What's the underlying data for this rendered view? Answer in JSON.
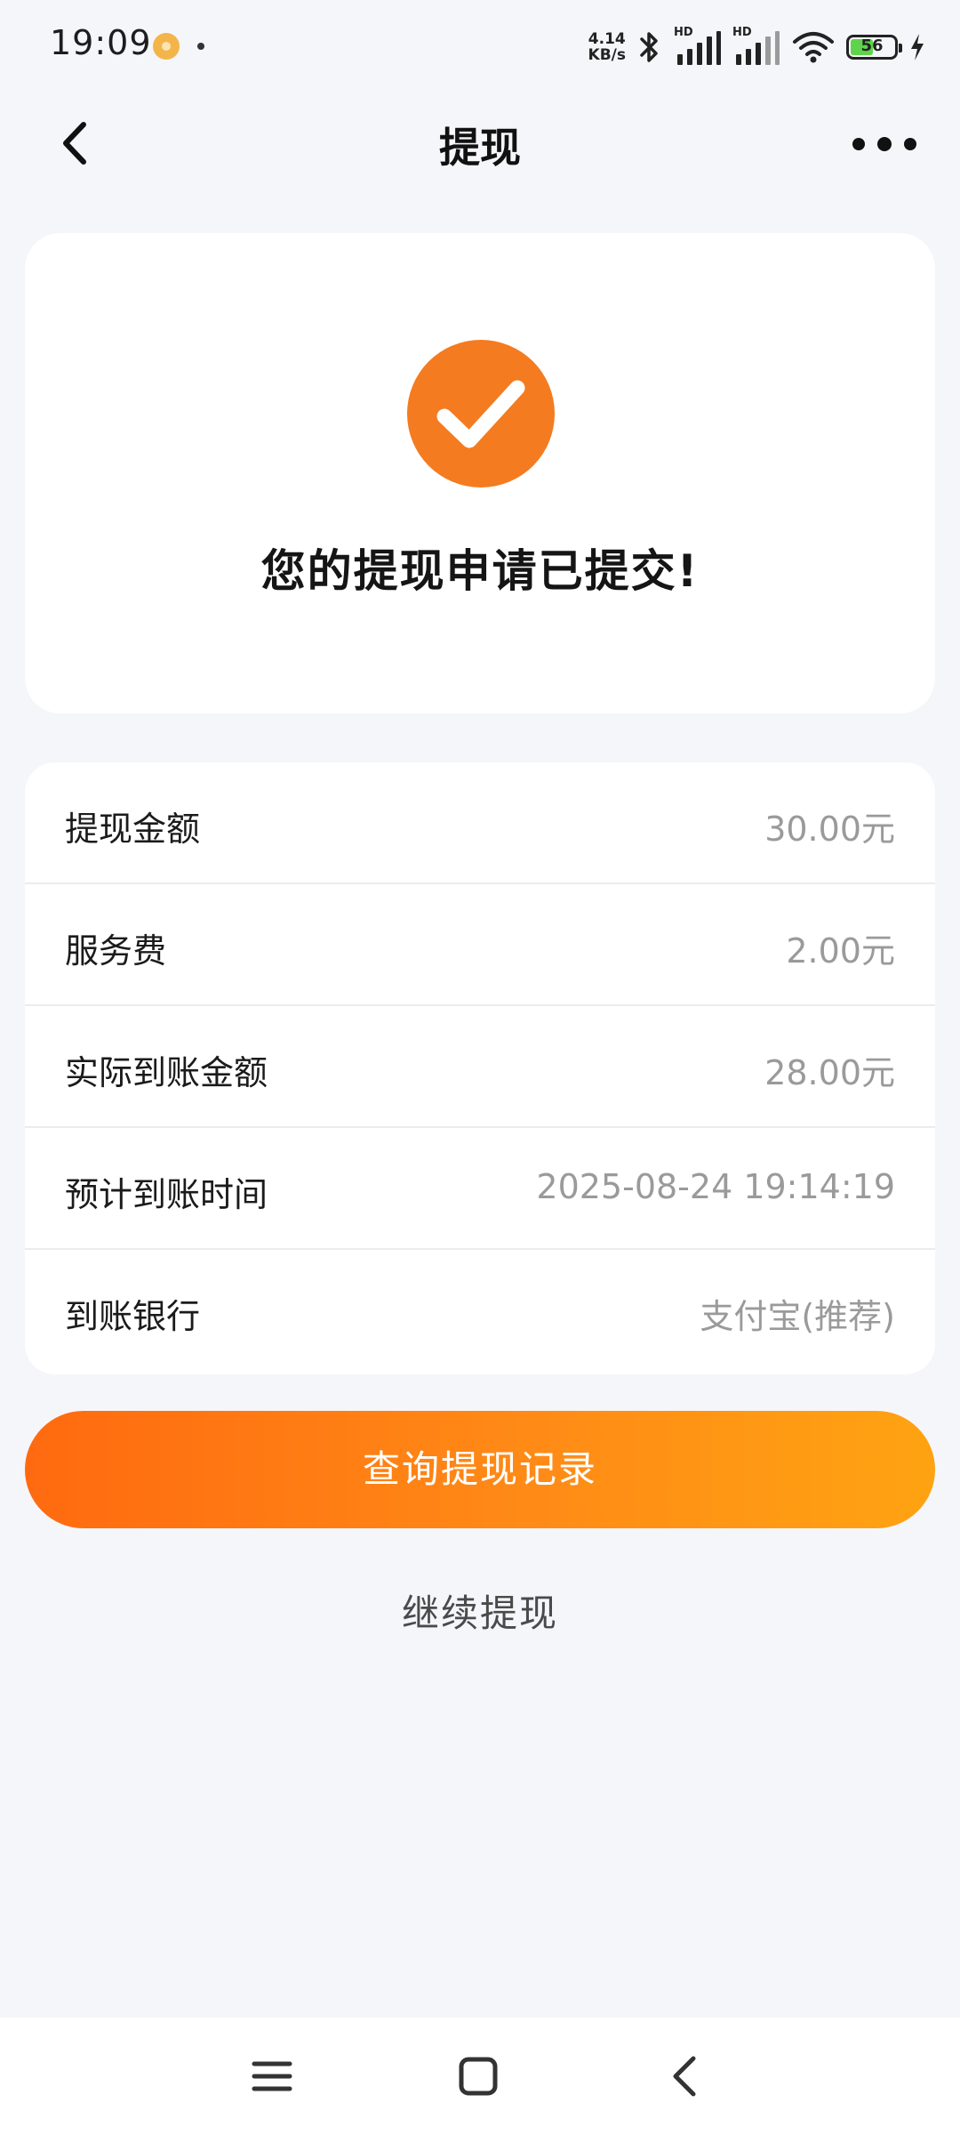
{
  "status_bar": {
    "time": "19:09",
    "net_speed_value": "4.14",
    "net_speed_unit": "KB/s",
    "signal_label_1": "HD",
    "signal_label_2": "HD",
    "battery_level": "56",
    "battery_fraction": 0.56,
    "icons": [
      "notification-app-icon",
      "bluetooth-icon",
      "signal-icon",
      "signal-icon",
      "wifi-icon",
      "battery-icon",
      "charging-icon"
    ]
  },
  "header": {
    "title": "提现",
    "back_icon": "chevron-left-icon",
    "more_icon": "more-dots-icon"
  },
  "success": {
    "icon": "check-circle-icon",
    "accent_color": "#f47b20",
    "message": "您的提现申请已提交!"
  },
  "details": [
    {
      "label": "提现金额",
      "value": "30.00元"
    },
    {
      "label": "服务费",
      "value": "2.00元"
    },
    {
      "label": "实际到账金额",
      "value": "28.00元"
    },
    {
      "label": "预计到账时间",
      "value": "2025-08-24 19:14:19"
    },
    {
      "label": "到账银行",
      "value": "支付宝(推荐)"
    }
  ],
  "actions": {
    "primary_label": "查询提现记录",
    "primary_gradient": [
      "#ff6a10",
      "#ffa312"
    ],
    "secondary_label": "继续提现"
  },
  "nav_bar": {
    "icons": [
      "menu-icon",
      "home-square-icon",
      "back-chevron-icon"
    ]
  }
}
